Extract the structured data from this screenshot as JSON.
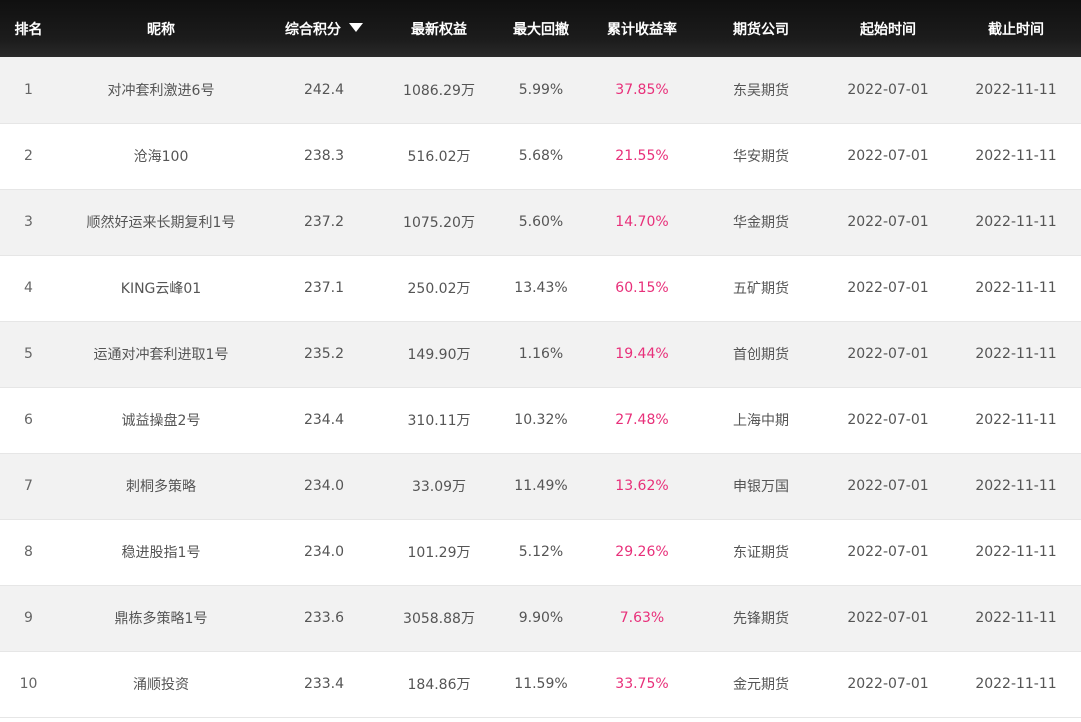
{
  "headers": {
    "rank": "排名",
    "nickname": "昵称",
    "score": "综合积分",
    "equity": "最新权益",
    "drawdown": "最大回撤",
    "return": "累计收益率",
    "company": "期货公司",
    "start": "起始时间",
    "end": "截止时间"
  },
  "sort_icon": "triangle-down-icon",
  "accent_color": "#e8307a",
  "rows": [
    {
      "rank": "1",
      "nickname": "对冲套利激进6号",
      "score": "242.4",
      "equity": "1086.29万",
      "drawdown": "5.99%",
      "return": "37.85%",
      "company": "东吴期货",
      "start": "2022-07-01",
      "end": "2022-11-11"
    },
    {
      "rank": "2",
      "nickname": "沧海100",
      "score": "238.3",
      "equity": "516.02万",
      "drawdown": "5.68%",
      "return": "21.55%",
      "company": "华安期货",
      "start": "2022-07-01",
      "end": "2022-11-11"
    },
    {
      "rank": "3",
      "nickname": "顺然好运来长期复利1号",
      "score": "237.2",
      "equity": "1075.20万",
      "drawdown": "5.60%",
      "return": "14.70%",
      "company": "华金期货",
      "start": "2022-07-01",
      "end": "2022-11-11"
    },
    {
      "rank": "4",
      "nickname": "KING云峰01",
      "score": "237.1",
      "equity": "250.02万",
      "drawdown": "13.43%",
      "return": "60.15%",
      "company": "五矿期货",
      "start": "2022-07-01",
      "end": "2022-11-11"
    },
    {
      "rank": "5",
      "nickname": "运通对冲套利进取1号",
      "score": "235.2",
      "equity": "149.90万",
      "drawdown": "1.16%",
      "return": "19.44%",
      "company": "首创期货",
      "start": "2022-07-01",
      "end": "2022-11-11"
    },
    {
      "rank": "6",
      "nickname": "诚益操盘2号",
      "score": "234.4",
      "equity": "310.11万",
      "drawdown": "10.32%",
      "return": "27.48%",
      "company": "上海中期",
      "start": "2022-07-01",
      "end": "2022-11-11"
    },
    {
      "rank": "7",
      "nickname": "刺桐多策略",
      "score": "234.0",
      "equity": "33.09万",
      "drawdown": "11.49%",
      "return": "13.62%",
      "company": "申银万国",
      "start": "2022-07-01",
      "end": "2022-11-11"
    },
    {
      "rank": "8",
      "nickname": "稳进股指1号",
      "score": "234.0",
      "equity": "101.29万",
      "drawdown": "5.12%",
      "return": "29.26%",
      "company": "东证期货",
      "start": "2022-07-01",
      "end": "2022-11-11"
    },
    {
      "rank": "9",
      "nickname": "鼎栋多策略1号",
      "score": "233.6",
      "equity": "3058.88万",
      "drawdown": "9.90%",
      "return": "7.63%",
      "company": "先锋期货",
      "start": "2022-07-01",
      "end": "2022-11-11"
    },
    {
      "rank": "10",
      "nickname": "涌顺投资",
      "score": "233.4",
      "equity": "184.86万",
      "drawdown": "11.59%",
      "return": "33.75%",
      "company": "金元期货",
      "start": "2022-07-01",
      "end": "2022-11-11"
    }
  ]
}
